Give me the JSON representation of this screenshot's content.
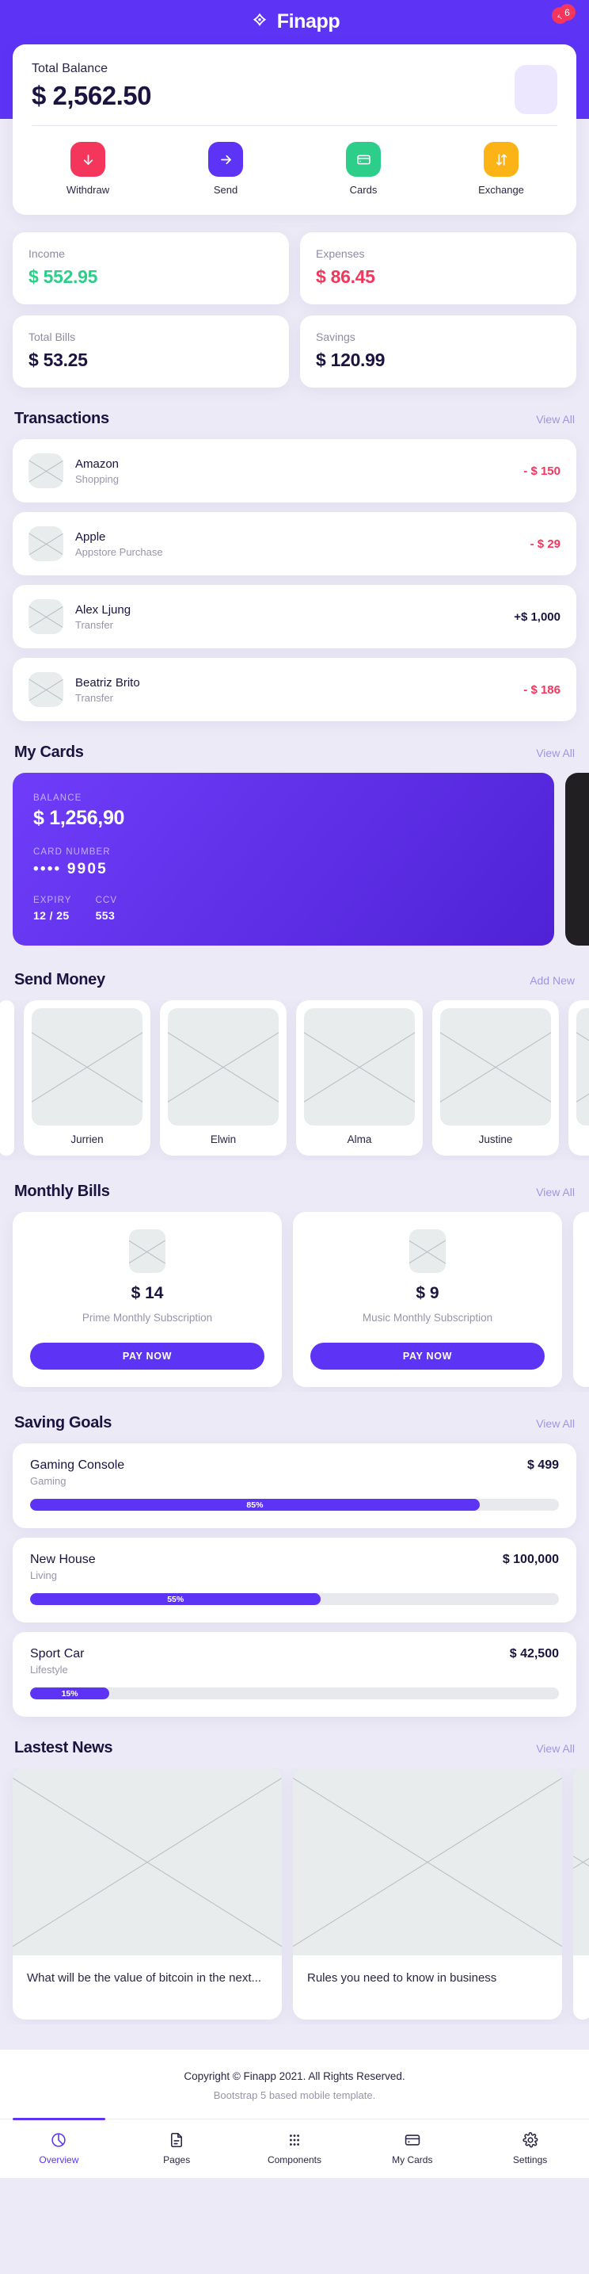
{
  "colors": {
    "brand_purple": "#5d33f6",
    "green": "#2dce89",
    "red": "#f5365c",
    "yellow": "#fcb316",
    "dark_navy": "#1c1340",
    "page_bg": "#eceaf6",
    "muted": "#9795aa"
  },
  "header": {
    "brand_name": "Finapp",
    "logo_icon": "finapp-logo-icon",
    "notification_badge": "4",
    "avatar_badge": "6",
    "avatar_icon": "avatar-placeholder"
  },
  "balance": {
    "label": "Total Balance",
    "amount": "$ 2,562.50",
    "actions": [
      {
        "label": "Withdraw",
        "icon": "arrow-down-icon",
        "color": "#f5365c"
      },
      {
        "label": "Send",
        "icon": "arrow-right-icon",
        "color": "#5d33f6"
      },
      {
        "label": "Cards",
        "icon": "credit-card-icon",
        "color": "#2dce89"
      },
      {
        "label": "Exchange",
        "icon": "exchange-arrows-icon",
        "color": "#fcb316"
      }
    ]
  },
  "stats": [
    {
      "label": "Income",
      "value": "$ 552.95",
      "color": "#2dce89"
    },
    {
      "label": "Expenses",
      "value": "$ 86.45",
      "color": "#f5365c"
    },
    {
      "label": "Total Bills",
      "value": "$ 53.25",
      "color": "#1c1340"
    },
    {
      "label": "Savings",
      "value": "$ 120.99",
      "color": "#1c1340"
    }
  ],
  "transactions": {
    "title": "Transactions",
    "link": "View All",
    "items": [
      {
        "name": "Amazon",
        "sub": "Shopping",
        "amount": "- $ 150",
        "color": "#f5365c"
      },
      {
        "name": "Apple",
        "sub": "Appstore Purchase",
        "amount": "- $ 29",
        "color": "#f5365c"
      },
      {
        "name": "Alex Ljung",
        "sub": "Transfer",
        "amount": "+$ 1,000",
        "color": "#1c1340"
      },
      {
        "name": "Beatriz Brito",
        "sub": "Transfer",
        "amount": "- $ 186",
        "color": "#f5365c"
      }
    ]
  },
  "my_cards": {
    "title": "My Cards",
    "link": "View All",
    "card": {
      "balance_label": "BALANCE",
      "balance_value": "$ 1,256,90",
      "number_label": "CARD NUMBER",
      "number_value": "•••• 9905",
      "expiry_label": "EXPIRY",
      "expiry_value": "12 / 25",
      "ccv_label": "CCV",
      "ccv_value": "553"
    }
  },
  "send_money": {
    "title": "Send Money",
    "link": "Add New",
    "people": [
      "Jurrien",
      "Elwin",
      "Alma",
      "Justine"
    ]
  },
  "monthly_bills": {
    "title": "Monthly Bills",
    "link": "View All",
    "items": [
      {
        "amount": "$ 14",
        "desc": "Prime Monthly Subscription",
        "button": "PAY NOW"
      },
      {
        "amount": "$ 9",
        "desc": "Music Monthly Subscription",
        "button": "PAY NOW"
      }
    ]
  },
  "saving_goals": {
    "title": "Saving Goals",
    "link": "View All",
    "items": [
      {
        "name": "Gaming Console",
        "category": "Gaming",
        "amount": "$ 499",
        "percent_label": "85%",
        "percent": 85
      },
      {
        "name": "New House",
        "category": "Living",
        "amount": "$ 100,000",
        "percent_label": "55%",
        "percent": 55
      },
      {
        "name": "Sport Car",
        "category": "Lifestyle",
        "amount": "$ 42,500",
        "percent_label": "15%",
        "percent": 15
      }
    ]
  },
  "news": {
    "title": "Lastest News",
    "link": "View All",
    "items": [
      {
        "title": "What will be the value of bitcoin in the next..."
      },
      {
        "title": "Rules you need to know in business"
      }
    ]
  },
  "footer": {
    "line1": "Copyright © Finapp 2021. All Rights Reserved.",
    "line2": "Bootstrap 5 based mobile template."
  },
  "bottom_nav": [
    {
      "label": "Overview",
      "icon": "pie-chart-icon",
      "active": true
    },
    {
      "label": "Pages",
      "icon": "document-icon",
      "active": false
    },
    {
      "label": "Components",
      "icon": "grid-dots-icon",
      "active": false
    },
    {
      "label": "My Cards",
      "icon": "credit-card-icon",
      "active": false
    },
    {
      "label": "Settings",
      "icon": "gear-icon",
      "active": false
    }
  ]
}
